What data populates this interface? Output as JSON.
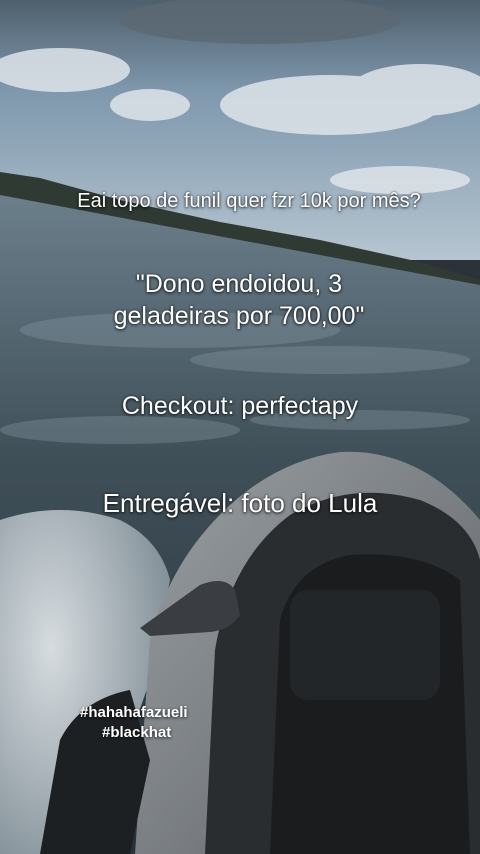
{
  "overlay": {
    "line1": "Eai topo de funil quer fzr 10k por mês?",
    "quote_line1": "\"Dono endoidou, 3",
    "quote_line2": "geladeiras por 700,00\"",
    "checkout": "Checkout: perfectapy",
    "entregavel": "Entregável: foto do Lula"
  },
  "hashtags": [
    "#hahahafazueli",
    "#blackhat"
  ],
  "colors": {
    "text": "#ffffff",
    "sky": "#8fa9bd",
    "water": "#3b4a52",
    "hull": "#7d8287"
  },
  "background_scene": "jet-ski-on-water"
}
